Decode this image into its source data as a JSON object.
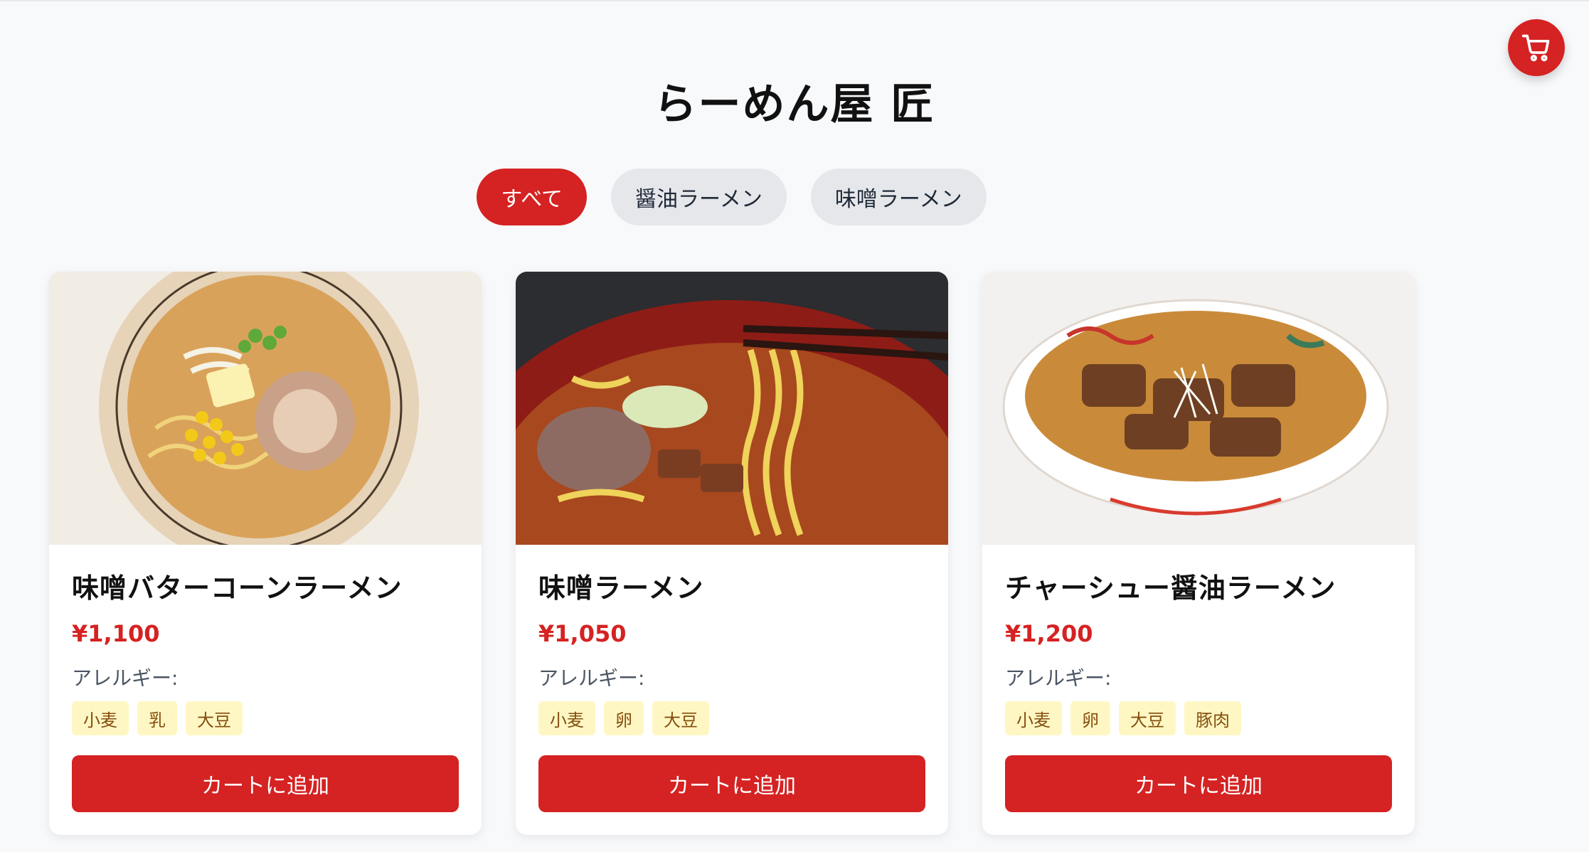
{
  "header": {
    "title": "らーめん屋 匠"
  },
  "cart": {
    "icon": "shopping-cart-icon",
    "color": "#d52222"
  },
  "filters": [
    {
      "label": "すべて",
      "active": true
    },
    {
      "label": "醤油ラーメン",
      "active": false
    },
    {
      "label": "味噌ラーメン",
      "active": false
    }
  ],
  "menu": [
    {
      "name": "味噌バターコーンラーメン",
      "price": "¥1,100",
      "allergy_label": "アレルギー:",
      "allergens": [
        "小麦",
        "乳",
        "大豆"
      ],
      "button": "カートに追加",
      "image": "miso-butter-corn-ramen-photo"
    },
    {
      "name": "味噌ラーメン",
      "price": "¥1,050",
      "allergy_label": "アレルギー:",
      "allergens": [
        "小麦",
        "卵",
        "大豆"
      ],
      "button": "カートに追加",
      "image": "miso-ramen-photo"
    },
    {
      "name": "チャーシュー醤油ラーメン",
      "price": "¥1,200",
      "allergy_label": "アレルギー:",
      "allergens": [
        "小麦",
        "卵",
        "大豆",
        "豚肉"
      ],
      "button": "カートに追加",
      "image": "chashu-shoyu-ramen-photo"
    }
  ],
  "colors": {
    "accent": "#d52222",
    "tag_bg": "#fef7c3",
    "tag_text": "#854d0e",
    "pill_bg": "#e5e7eb"
  }
}
